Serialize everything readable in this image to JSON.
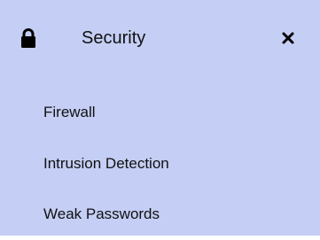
{
  "panel": {
    "title": "Security",
    "lock_icon": "lock-icon",
    "close_icon": "close-icon",
    "colors": {
      "background": "#c5cef4",
      "text": "#111111"
    }
  },
  "menu": {
    "items": [
      {
        "label": "Firewall"
      },
      {
        "label": "Intrusion Detection"
      },
      {
        "label": "Weak Passwords"
      }
    ]
  }
}
